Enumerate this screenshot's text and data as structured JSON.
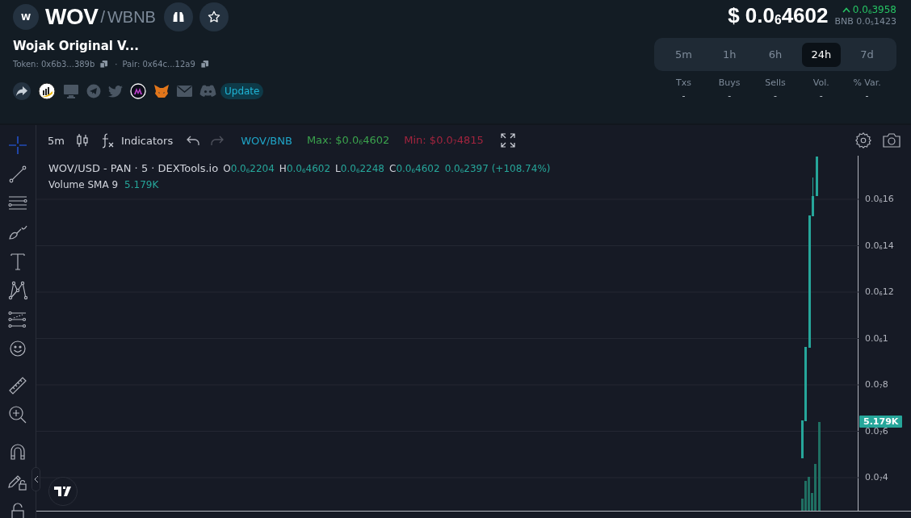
{
  "token": {
    "logo_letter": "W",
    "symbol": "WOV",
    "separator": "/",
    "quote": "WBNB",
    "name": "Wojak Original V...",
    "token_address": "Token: 0x6b3...389b",
    "dot": "·",
    "pair_address": "Pair: 0x64c...12a9",
    "update_label": "Update"
  },
  "price": {
    "value": "$ 0.0$_{6}$4602",
    "change": "0.0$_{6}$3958",
    "bnb_price": "BNB 0.0$_{5}$1423"
  },
  "timeframes": [
    {
      "label": "5m",
      "selected": false
    },
    {
      "label": "1h",
      "selected": false
    },
    {
      "label": "6h",
      "selected": false
    },
    {
      "label": "24h",
      "selected": true
    },
    {
      "label": "7d",
      "selected": false
    }
  ],
  "stats": [
    {
      "label": "Txs",
      "value": "-"
    },
    {
      "label": "Buys",
      "value": "-"
    },
    {
      "label": "Sells",
      "value": "-"
    },
    {
      "label": "Vol.",
      "value": "-"
    },
    {
      "label": "% Var.",
      "value": "-"
    }
  ],
  "chart_toolbar": {
    "interval": "5m",
    "indicators": "Indicators",
    "pair": "WOV/BNB",
    "max": "Max: $0.0$_{6}$4602",
    "min": "Min: $0.0$_{7}$4815"
  },
  "tools": [
    {
      "kind": "crosshair",
      "selected": true
    },
    {
      "kind": "trend-line",
      "selected": false
    },
    {
      "kind": "lines",
      "selected": false
    },
    {
      "kind": "brush",
      "selected": false
    },
    {
      "kind": "text",
      "selected": false
    },
    {
      "kind": "pattern",
      "selected": false
    },
    {
      "kind": "fib",
      "selected": false
    },
    {
      "kind": "smiley",
      "selected": false
    },
    {
      "kind": "ruler",
      "selected": false
    },
    {
      "kind": "zoom",
      "selected": false
    },
    {
      "kind": "magnet",
      "selected": false
    },
    {
      "kind": "pencil-lock",
      "selected": false
    },
    {
      "kind": "lock",
      "selected": false
    }
  ],
  "legend": {
    "title": "WOV/USD - PAN · 5 · DEXTools.io",
    "ohlc": [
      {
        "label": "O",
        "value": "0.0$_{6}$2204"
      },
      {
        "label": "H",
        "value": "0.0$_{6}$4602"
      },
      {
        "label": "L",
        "value": "0.0$_{6}$2248"
      },
      {
        "label": "C",
        "value": "0.0$_{6}$4602"
      }
    ],
    "change": "0.0$_{6}$2397 (+108.74%)",
    "volume_label": "Volume SMA 9",
    "volume_value": "5.179K"
  },
  "price_axis": {
    "labels": [
      "0.0$_{6}$16",
      "0.0$_{6}$14",
      "0.0$_{6}$12",
      "0.0$_{6}$1",
      "0.0$_{7}$8",
      "0.0$_{7}$6",
      "0.0$_{7}$4"
    ],
    "volume_badge": "5.179K"
  }
}
